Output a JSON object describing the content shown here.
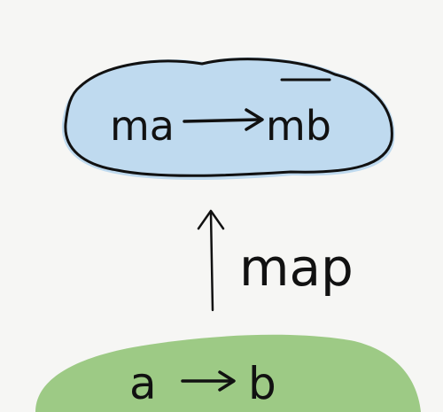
{
  "top_cloud": {
    "left_label": "ma",
    "right_label": "mb",
    "fill_color": "#bcd8ee",
    "label_color": "#b3161b",
    "arrow_color": "#111111"
  },
  "lift_arrow": {
    "label": "map"
  },
  "bottom_hill": {
    "left_label": "a",
    "right_label": "b",
    "fill_color": "#98c77e"
  }
}
